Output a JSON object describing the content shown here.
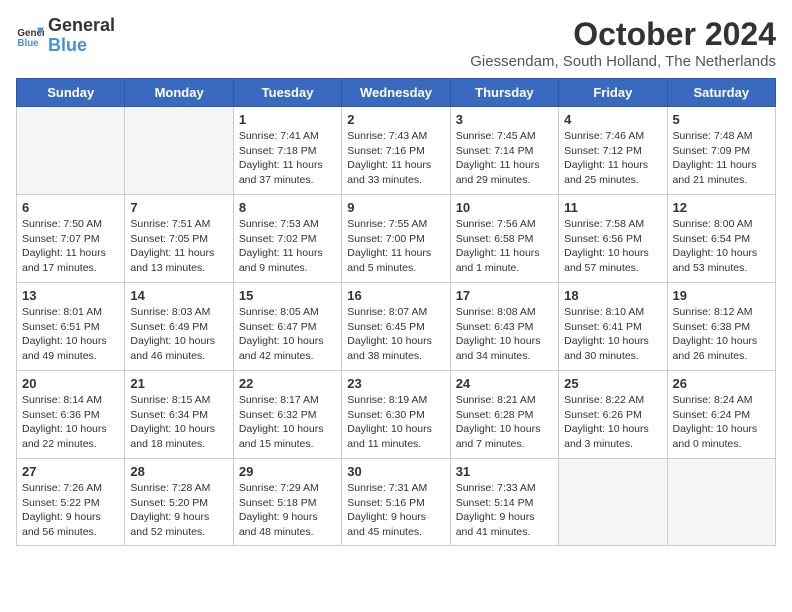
{
  "logo": {
    "line1": "General",
    "line2": "Blue"
  },
  "title": "October 2024",
  "location": "Giessendam, South Holland, The Netherlands",
  "days_of_week": [
    "Sunday",
    "Monday",
    "Tuesday",
    "Wednesday",
    "Thursday",
    "Friday",
    "Saturday"
  ],
  "weeks": [
    [
      {
        "day": "",
        "empty": true
      },
      {
        "day": "",
        "empty": true
      },
      {
        "day": "1",
        "sunrise": "7:41 AM",
        "sunset": "7:18 PM",
        "daylight": "11 hours and 37 minutes."
      },
      {
        "day": "2",
        "sunrise": "7:43 AM",
        "sunset": "7:16 PM",
        "daylight": "11 hours and 33 minutes."
      },
      {
        "day": "3",
        "sunrise": "7:45 AM",
        "sunset": "7:14 PM",
        "daylight": "11 hours and 29 minutes."
      },
      {
        "day": "4",
        "sunrise": "7:46 AM",
        "sunset": "7:12 PM",
        "daylight": "11 hours and 25 minutes."
      },
      {
        "day": "5",
        "sunrise": "7:48 AM",
        "sunset": "7:09 PM",
        "daylight": "11 hours and 21 minutes."
      }
    ],
    [
      {
        "day": "6",
        "sunrise": "7:50 AM",
        "sunset": "7:07 PM",
        "daylight": "11 hours and 17 minutes."
      },
      {
        "day": "7",
        "sunrise": "7:51 AM",
        "sunset": "7:05 PM",
        "daylight": "11 hours and 13 minutes."
      },
      {
        "day": "8",
        "sunrise": "7:53 AM",
        "sunset": "7:02 PM",
        "daylight": "11 hours and 9 minutes."
      },
      {
        "day": "9",
        "sunrise": "7:55 AM",
        "sunset": "7:00 PM",
        "daylight": "11 hours and 5 minutes."
      },
      {
        "day": "10",
        "sunrise": "7:56 AM",
        "sunset": "6:58 PM",
        "daylight": "11 hours and 1 minute."
      },
      {
        "day": "11",
        "sunrise": "7:58 AM",
        "sunset": "6:56 PM",
        "daylight": "10 hours and 57 minutes."
      },
      {
        "day": "12",
        "sunrise": "8:00 AM",
        "sunset": "6:54 PM",
        "daylight": "10 hours and 53 minutes."
      }
    ],
    [
      {
        "day": "13",
        "sunrise": "8:01 AM",
        "sunset": "6:51 PM",
        "daylight": "10 hours and 49 minutes."
      },
      {
        "day": "14",
        "sunrise": "8:03 AM",
        "sunset": "6:49 PM",
        "daylight": "10 hours and 46 minutes."
      },
      {
        "day": "15",
        "sunrise": "8:05 AM",
        "sunset": "6:47 PM",
        "daylight": "10 hours and 42 minutes."
      },
      {
        "day": "16",
        "sunrise": "8:07 AM",
        "sunset": "6:45 PM",
        "daylight": "10 hours and 38 minutes."
      },
      {
        "day": "17",
        "sunrise": "8:08 AM",
        "sunset": "6:43 PM",
        "daylight": "10 hours and 34 minutes."
      },
      {
        "day": "18",
        "sunrise": "8:10 AM",
        "sunset": "6:41 PM",
        "daylight": "10 hours and 30 minutes."
      },
      {
        "day": "19",
        "sunrise": "8:12 AM",
        "sunset": "6:38 PM",
        "daylight": "10 hours and 26 minutes."
      }
    ],
    [
      {
        "day": "20",
        "sunrise": "8:14 AM",
        "sunset": "6:36 PM",
        "daylight": "10 hours and 22 minutes."
      },
      {
        "day": "21",
        "sunrise": "8:15 AM",
        "sunset": "6:34 PM",
        "daylight": "10 hours and 18 minutes."
      },
      {
        "day": "22",
        "sunrise": "8:17 AM",
        "sunset": "6:32 PM",
        "daylight": "10 hours and 15 minutes."
      },
      {
        "day": "23",
        "sunrise": "8:19 AM",
        "sunset": "6:30 PM",
        "daylight": "10 hours and 11 minutes."
      },
      {
        "day": "24",
        "sunrise": "8:21 AM",
        "sunset": "6:28 PM",
        "daylight": "10 hours and 7 minutes."
      },
      {
        "day": "25",
        "sunrise": "8:22 AM",
        "sunset": "6:26 PM",
        "daylight": "10 hours and 3 minutes."
      },
      {
        "day": "26",
        "sunrise": "8:24 AM",
        "sunset": "6:24 PM",
        "daylight": "10 hours and 0 minutes."
      }
    ],
    [
      {
        "day": "27",
        "sunrise": "7:26 AM",
        "sunset": "5:22 PM",
        "daylight": "9 hours and 56 minutes."
      },
      {
        "day": "28",
        "sunrise": "7:28 AM",
        "sunset": "5:20 PM",
        "daylight": "9 hours and 52 minutes."
      },
      {
        "day": "29",
        "sunrise": "7:29 AM",
        "sunset": "5:18 PM",
        "daylight": "9 hours and 48 minutes."
      },
      {
        "day": "30",
        "sunrise": "7:31 AM",
        "sunset": "5:16 PM",
        "daylight": "9 hours and 45 minutes."
      },
      {
        "day": "31",
        "sunrise": "7:33 AM",
        "sunset": "5:14 PM",
        "daylight": "9 hours and 41 minutes."
      },
      {
        "day": "",
        "empty": true
      },
      {
        "day": "",
        "empty": true
      }
    ]
  ]
}
